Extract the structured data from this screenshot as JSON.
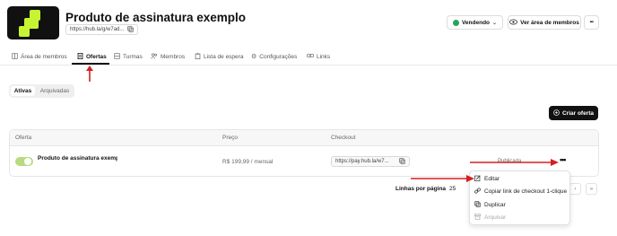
{
  "header": {
    "title": "Produto de assinatura exemplo",
    "url": "https://hub.la/g/w7ad...",
    "status_label": "Vendendo",
    "members_area_label": "Ver área de membros",
    "more_label": "•••"
  },
  "nav": {
    "items": [
      {
        "label": "Área de membros",
        "icon": "book-icon"
      },
      {
        "label": "Ofertas",
        "icon": "document-icon",
        "active": true
      },
      {
        "label": "Turmas",
        "icon": "grid-icon"
      },
      {
        "label": "Membros",
        "icon": "users-icon"
      },
      {
        "label": "Lista de espera",
        "icon": "clipboard-icon"
      },
      {
        "label": "Configurações",
        "icon": "gear-icon"
      },
      {
        "label": "Links",
        "icon": "link-icon"
      }
    ]
  },
  "subtabs": {
    "active": "Ativas",
    "inactive": "Arquivadas"
  },
  "create_offer_label": "Criar oferta",
  "table": {
    "columns": [
      "Oferta",
      "Preço",
      "Checkout"
    ],
    "row": {
      "offer": "Produto de assinatura exemplo",
      "price": "R$ 199,99 / mensal",
      "checkout_url": "https://pay.hub.la/w7...",
      "status": "Publicada",
      "more": "•••"
    }
  },
  "pagination": {
    "rows_label": "Linhas por página",
    "rows_value": "25",
    "next": "›",
    "last": "»"
  },
  "context_menu": {
    "items": [
      {
        "label": "Editar",
        "icon": "edit-icon"
      },
      {
        "label": "Copiar link de checkout 1-clique",
        "icon": "link-icon"
      },
      {
        "label": "Duplicar",
        "icon": "copy-icon"
      },
      {
        "label": "Arquivar",
        "icon": "archive-icon",
        "disabled": true
      }
    ]
  },
  "colors": {
    "accent_green": "#22a55b",
    "toggle_green": "#b7dc80",
    "logo_green": "#c6f432",
    "annotation_red": "#d32020",
    "primary_dark": "#111111"
  }
}
